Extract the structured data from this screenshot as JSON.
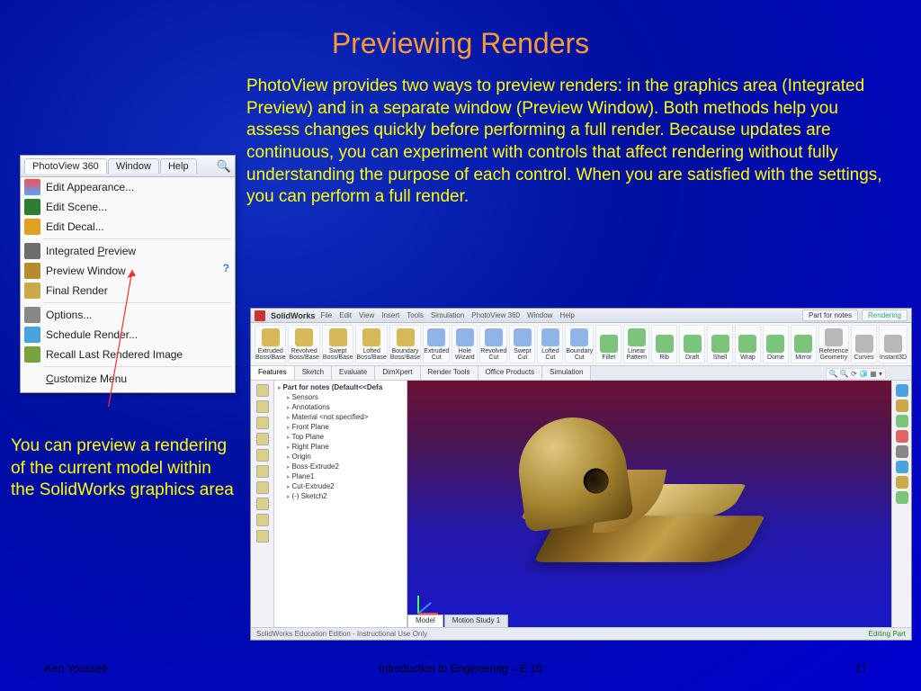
{
  "slide": {
    "title": "Previewing Renders",
    "body": "PhotoView provides two ways to preview renders: in the graphics area (Integrated Preview) and in a separate window (Preview Window). Both methods help you assess changes quickly before performing a full render. Because updates are continuous, you can experiment with controls that affect rendering without fully understanding the purpose of each control. When you are satisfied with the settings, you can perform a full render.",
    "caption": "You can preview a rendering of the current model within the SolidWorks graphics area",
    "footer_left": "Ken Youssefi",
    "footer_center": "Introduction to Engineering – E 10",
    "footer_right": "17"
  },
  "menu": {
    "tabs": [
      "PhotoView 360",
      "Window",
      "Help"
    ],
    "items": [
      {
        "label": "Edit Appearance...",
        "icon": "appearance",
        "color": "linear-gradient(#ff4d4d,#4da6ff)"
      },
      {
        "label": "Edit Scene...",
        "icon": "scene",
        "color": "#2e7d32"
      },
      {
        "label": "Edit Decal...",
        "icon": "decal",
        "color": "#e0a020"
      }
    ],
    "items2": [
      {
        "label": "Integrated Preview",
        "icon": "int-preview",
        "color": "#6d6d6d"
      },
      {
        "label": "Preview Window",
        "icon": "prev-window",
        "color": "#b88a2e"
      },
      {
        "label": "Final Render",
        "icon": "final-render",
        "color": "#caa94a"
      }
    ],
    "items3": [
      {
        "label": "Options...",
        "icon": "options",
        "color": "#888"
      },
      {
        "label": "Schedule Render...",
        "icon": "schedule",
        "color": "#4aa3df"
      },
      {
        "label": "Recall Last Rendered Image",
        "icon": "recall",
        "color": "#7aa23c"
      }
    ],
    "items4": [
      {
        "label": "Customize Menu",
        "icon": "customize",
        "color": "transparent"
      }
    ],
    "help_badge": "?"
  },
  "sw": {
    "app": "SolidWorks",
    "menus": [
      "File",
      "Edit",
      "View",
      "Insert",
      "Tools",
      "Simulation",
      "PhotoView 360",
      "Window",
      "Help"
    ],
    "searchbox": "Part for notes",
    "status_pill": "Rendering",
    "ribbon": [
      {
        "label": "Extruded Boss/Base",
        "c": "#d7b95a"
      },
      {
        "label": "Revolved Boss/Base",
        "c": "#d7b95a"
      },
      {
        "label": "Swept Boss/Base",
        "c": "#d7b95a"
      },
      {
        "label": "Lofted Boss/Base",
        "c": "#d7b95a"
      },
      {
        "label": "Boundary Boss/Base",
        "c": "#d7b95a"
      },
      {
        "label": "Extruded Cut",
        "c": "#8fb5e8"
      },
      {
        "label": "Hole Wizard",
        "c": "#8fb5e8"
      },
      {
        "label": "Revolved Cut",
        "c": "#8fb5e8"
      },
      {
        "label": "Swept Cut",
        "c": "#8fb5e8"
      },
      {
        "label": "Lofted Cut",
        "c": "#8fb5e8"
      },
      {
        "label": "Boundary Cut",
        "c": "#8fb5e8"
      },
      {
        "label": "Fillet",
        "c": "#7cc47c"
      },
      {
        "label": "Linear Pattern",
        "c": "#7cc47c"
      },
      {
        "label": "Rib",
        "c": "#7cc47c"
      },
      {
        "label": "Draft",
        "c": "#7cc47c"
      },
      {
        "label": "Shell",
        "c": "#7cc47c"
      },
      {
        "label": "Wrap",
        "c": "#7cc47c"
      },
      {
        "label": "Dome",
        "c": "#7cc47c"
      },
      {
        "label": "Mirror",
        "c": "#7cc47c"
      },
      {
        "label": "Reference Geometry",
        "c": "#b8b8b8"
      },
      {
        "label": "Curves",
        "c": "#b8b8b8"
      },
      {
        "label": "Instant3D",
        "c": "#b8b8b8"
      }
    ],
    "tabs": [
      "Features",
      "Sketch",
      "Evaluate",
      "DimXpert",
      "Render Tools",
      "Office Products",
      "Simulation"
    ],
    "active_tab": "Features",
    "tree_root": "Part for notes  (Default<<Defa",
    "tree": [
      "Sensors",
      "Annotations",
      "Material <not specified>",
      "Front Plane",
      "Top Plane",
      "Right Plane",
      "Origin",
      "Boss-Extrude2",
      "Plane1",
      "Cut-Extrude2",
      "(-) Sketch2"
    ],
    "bottom_tabs": [
      "Model",
      "Motion Study 1"
    ],
    "active_bottom": "Model",
    "status_left": "SolidWorks Education Edition - Instructional Use Only",
    "status_right": "Editing Part",
    "rtool_colors": [
      "#4aa3df",
      "#caa94a",
      "#7cc47c",
      "#d66",
      "#888",
      "#4aa3df",
      "#caa94a",
      "#7cc47c"
    ]
  }
}
